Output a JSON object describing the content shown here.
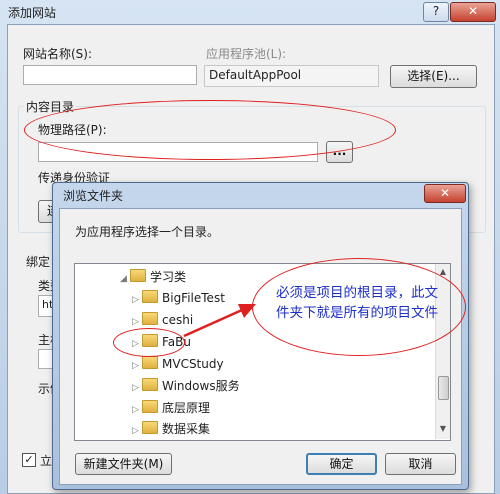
{
  "outer": {
    "title": "添加网站",
    "site_name_label": "网站名称(S):",
    "app_pool_label": "应用程序池(L):",
    "app_pool_value": "DefaultAppPool",
    "select_button": "选择(E)...",
    "content_dir_label": "内容目录",
    "physical_path_label": "物理路径(P):",
    "browse_button": "...",
    "pass_auth_label": "传递身份验证",
    "bind_label": "绑定",
    "type_label": "类型",
    "type_value": "htt",
    "host_label": "主机",
    "example_label": "示例",
    "connect_label": "连",
    "start_label": "立"
  },
  "dialog": {
    "title": "浏览文件夹",
    "prompt": "为应用程序选择一个目录。",
    "folders": [
      "学习类",
      "BigFileTest",
      "ceshi",
      "FaBu",
      "MVCStudy",
      "Windows服务",
      "底层原理",
      "数据采集"
    ],
    "new_folder_button": "新建文件夹(M)",
    "ok_button": "确定",
    "cancel_button": "取消"
  },
  "annotation": {
    "note": "必须是项目的根目录，此文件夹下就是所有的项目文件",
    "note_color": "#1d2fc7",
    "circle_color": "#e02020"
  }
}
